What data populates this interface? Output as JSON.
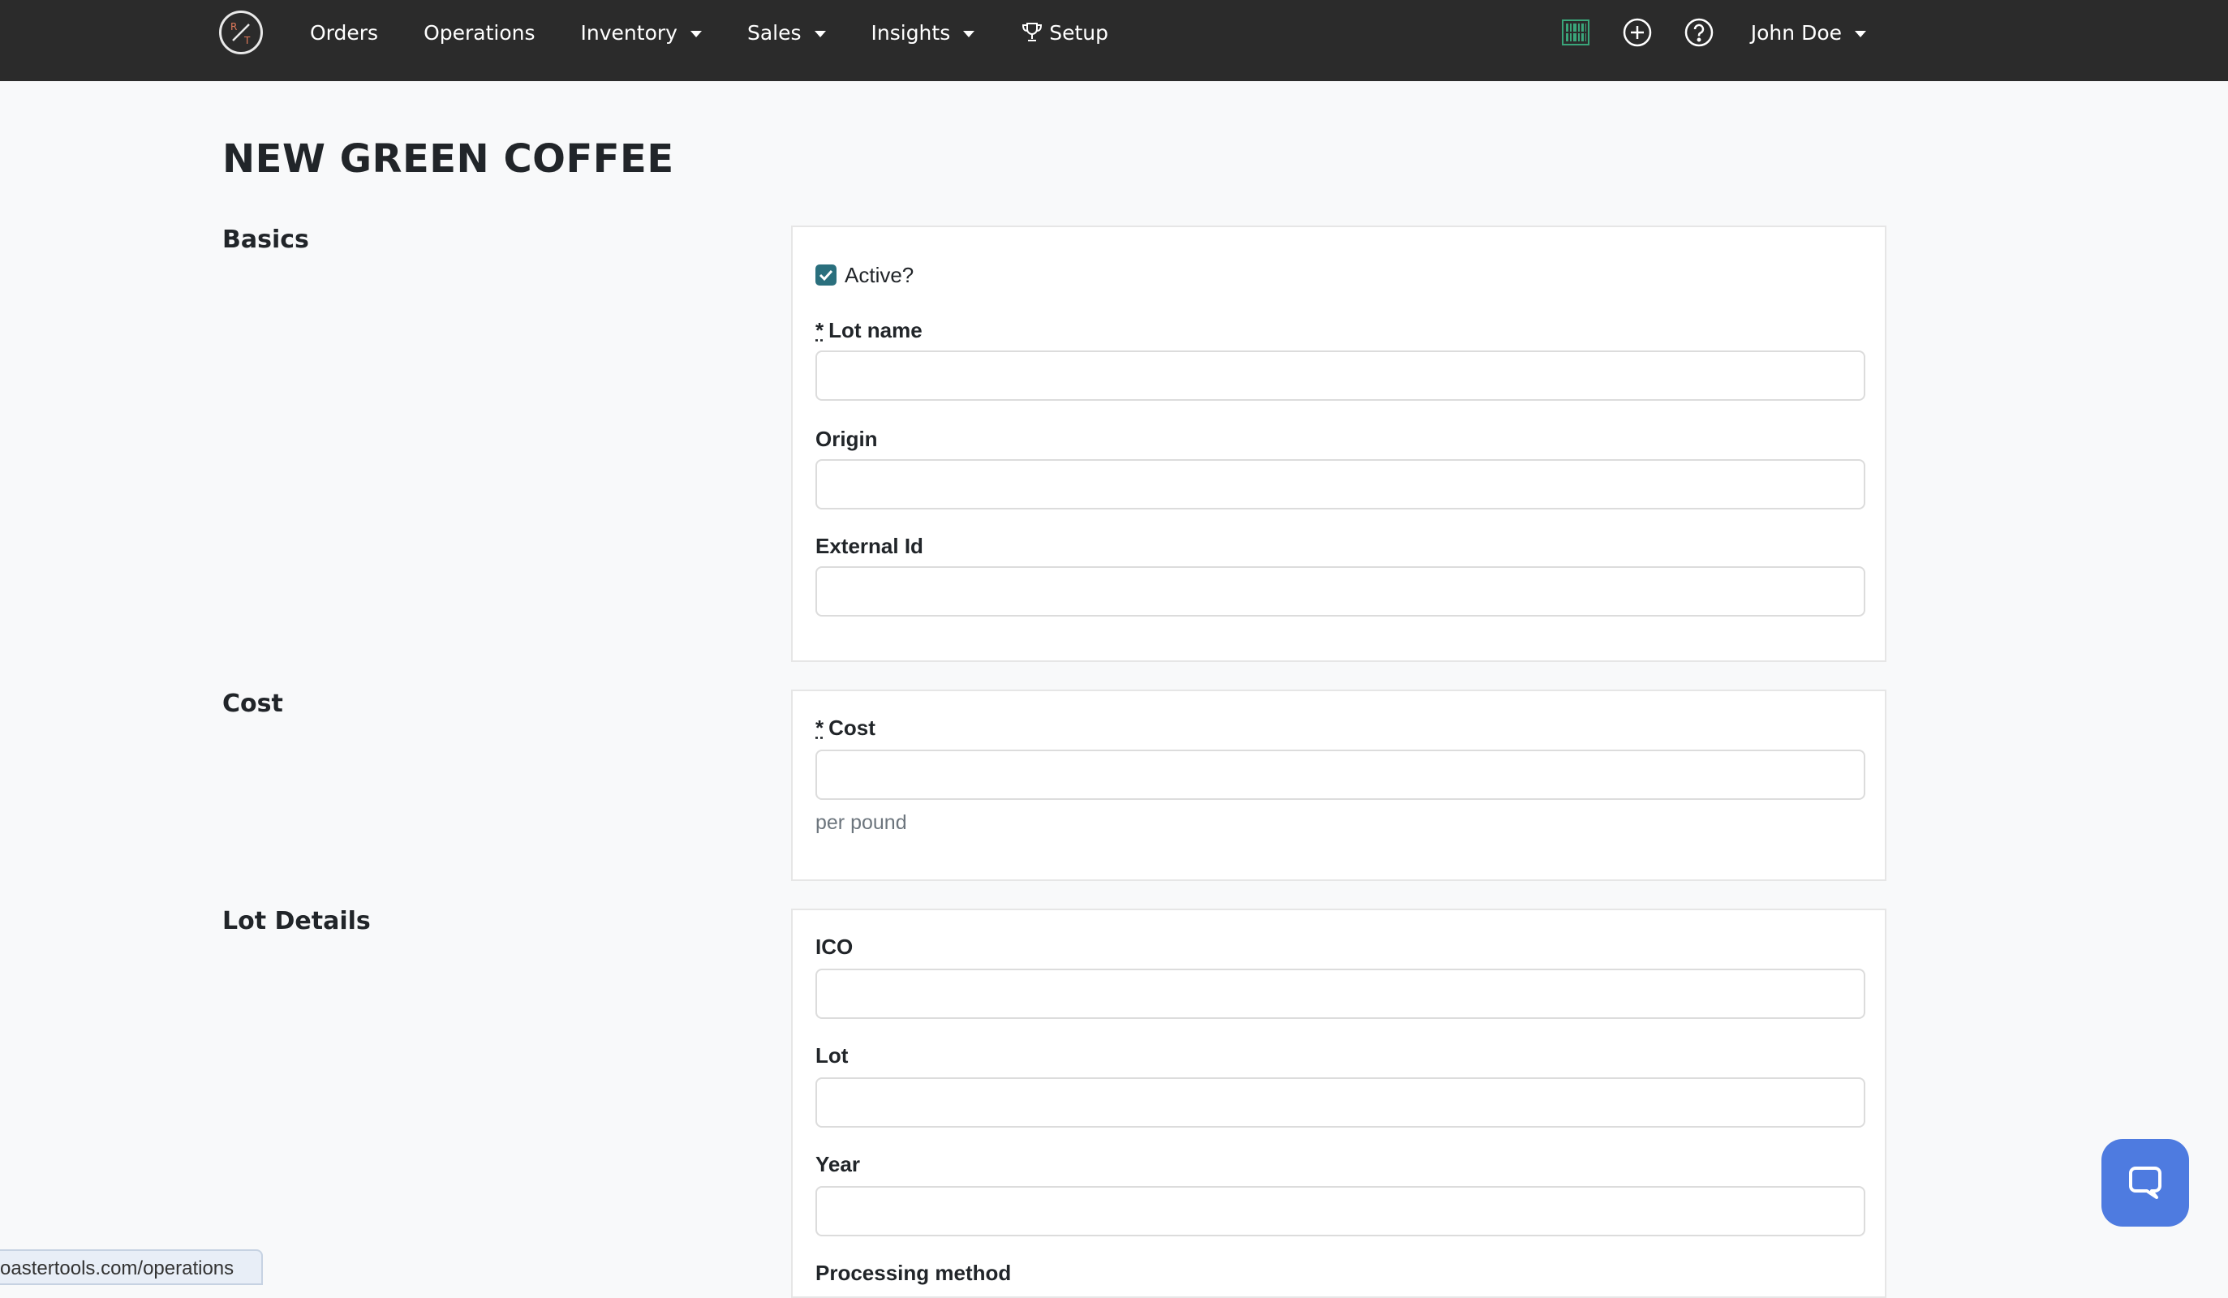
{
  "nav": {
    "items": [
      {
        "label": "Orders"
      },
      {
        "label": "Operations"
      },
      {
        "label": "Inventory"
      },
      {
        "label": "Sales"
      },
      {
        "label": "Insights"
      },
      {
        "label": "Setup"
      }
    ],
    "user_name": "John Doe"
  },
  "page": {
    "title": "NEW GREEN COFFEE"
  },
  "sections": {
    "basics": {
      "title": "Basics",
      "active_label": "Active?",
      "active_checked": true,
      "lot_name_required": "*",
      "lot_name_label": "Lot name",
      "lot_name_value": "",
      "origin_label": "Origin",
      "origin_value": "",
      "external_id_label": "External Id",
      "external_id_value": ""
    },
    "cost": {
      "title": "Cost",
      "cost_required": "*",
      "cost_label": "Cost",
      "cost_value": "",
      "cost_help": "per pound"
    },
    "lot_details": {
      "title": "Lot Details",
      "ico_label": "ICO",
      "ico_value": "",
      "lot_label": "Lot",
      "lot_value": "",
      "year_label": "Year",
      "year_value": "",
      "processing_label": "Processing method"
    }
  },
  "status_bar": {
    "url": "oastertools.com/operations"
  },
  "colors": {
    "navbar_bg": "#2b2b2b",
    "checkbox_accent": "#2a6f7d",
    "chat_button": "#4e7be0"
  },
  "icons": {
    "logo": "roastertools-logo-icon",
    "setup": "trophy-icon",
    "barcode": "barcode-icon",
    "add": "plus-circle-icon",
    "help": "question-circle-icon",
    "chat": "chat-bubble-icon"
  }
}
